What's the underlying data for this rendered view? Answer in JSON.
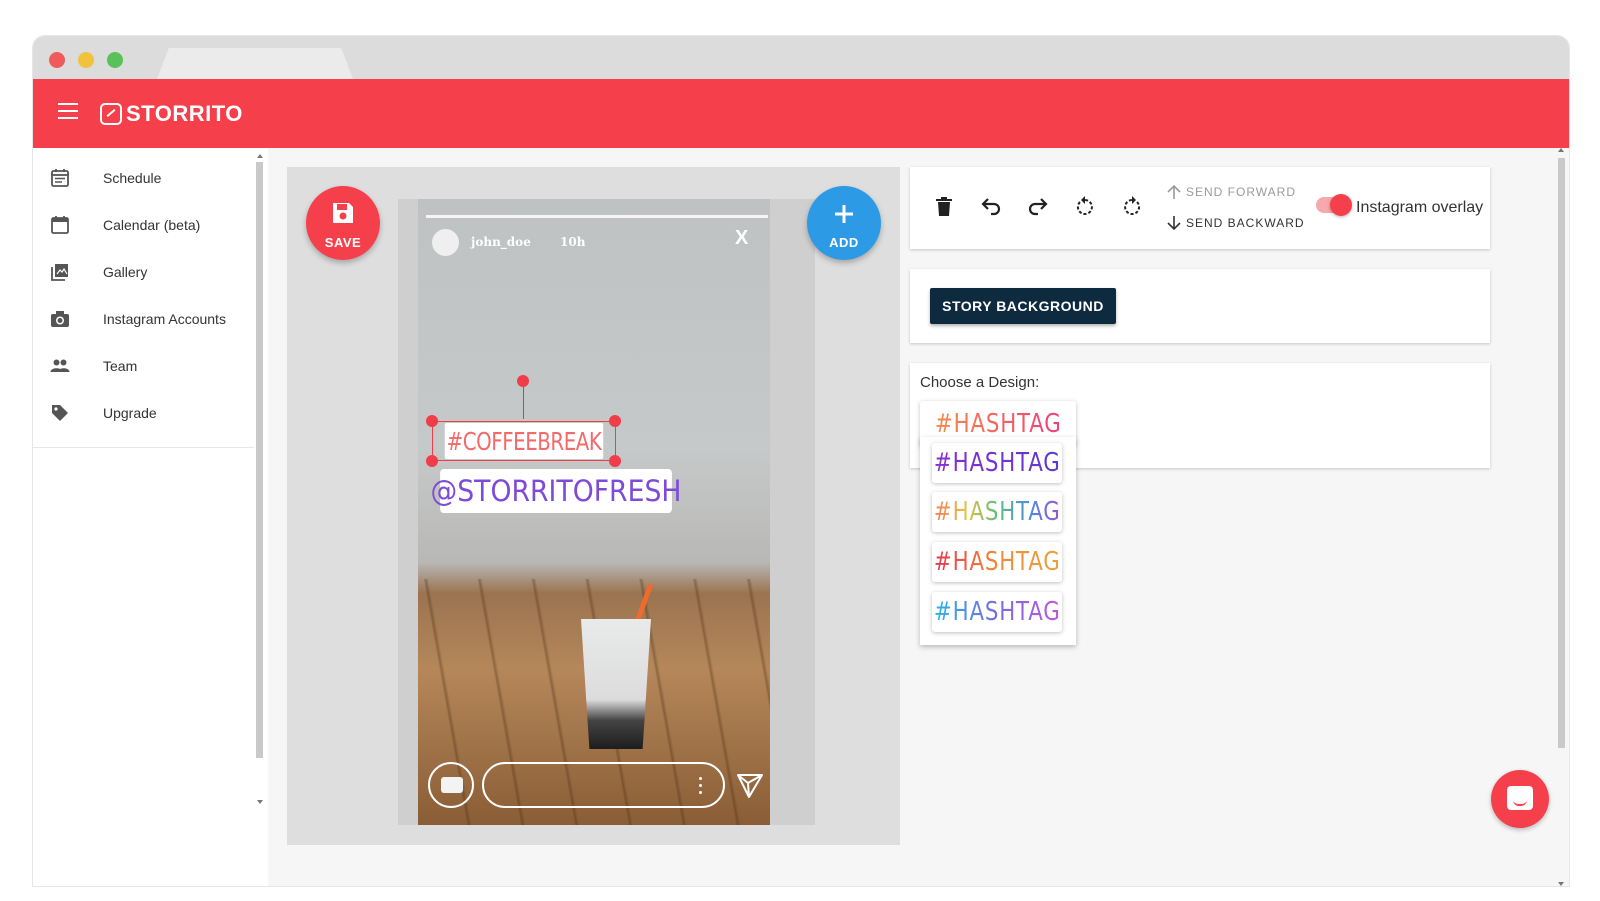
{
  "app": {
    "name": "STORRITO"
  },
  "sidebar": {
    "items": [
      {
        "label": "Schedule",
        "icon": "calendar-list-icon"
      },
      {
        "label": "Calendar (beta)",
        "icon": "calendar-icon"
      },
      {
        "label": "Gallery",
        "icon": "gallery-icon"
      },
      {
        "label": "Instagram Accounts",
        "icon": "camera-icon"
      },
      {
        "label": "Team",
        "icon": "people-icon"
      },
      {
        "label": "Upgrade",
        "icon": "tag-icon"
      }
    ]
  },
  "editor": {
    "save_label": "SAVE",
    "add_label": "ADD",
    "story": {
      "username": "john_doe",
      "time": "10h",
      "close": "X",
      "sticker_1": "#COFFEEBREAK",
      "sticker_2": "@STORRITOFRESH"
    }
  },
  "toolbar": {
    "send_forward": "SEND FORWARD",
    "send_backward": "SEND BACKWARD",
    "overlay_label": "Instagram overlay",
    "overlay_on": true
  },
  "background": {
    "button_label": "STORY BACKGROUND"
  },
  "design": {
    "label": "Choose a Design:",
    "selected": "#HASHTAG",
    "options": [
      "#HASHTAG",
      "#HASHTAG",
      "#HASHTAG",
      "#HASHTAG"
    ]
  },
  "colors": {
    "brand": "#f5404c",
    "add": "#2d9ae6",
    "background_button": "#0d2a3f"
  }
}
